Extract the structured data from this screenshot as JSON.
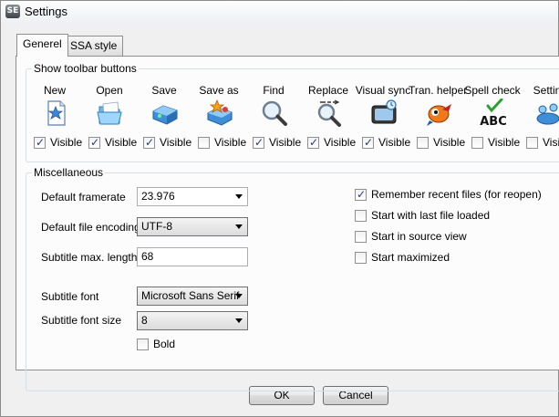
{
  "window": {
    "title": "Settings",
    "icon_text": "SE"
  },
  "tabs": [
    {
      "label": "Generel",
      "active": true
    },
    {
      "label": "SSA style",
      "active": false
    }
  ],
  "toolbar_group": {
    "title": "Show toolbar buttons",
    "visible_label": "Visible",
    "items": [
      {
        "label": "New",
        "icon": "new-file-star-icon",
        "visible": true
      },
      {
        "label": "Open",
        "icon": "open-folder-icon",
        "visible": true
      },
      {
        "label": "Save",
        "icon": "save-drive-icon",
        "visible": true
      },
      {
        "label": "Save as",
        "icon": "save-as-star-icon",
        "visible": false
      },
      {
        "label": "Find",
        "icon": "magnifier-icon",
        "visible": true
      },
      {
        "label": "Replace",
        "icon": "replace-magnifier-icon",
        "visible": true
      },
      {
        "label": "Visual sync",
        "icon": "visual-sync-tv-icon",
        "visible": true
      },
      {
        "label": "Tran. helper",
        "icon": "translate-helper-icon",
        "visible": false
      },
      {
        "label": "Spell check",
        "icon": "spell-check-abc-icon",
        "visible": false
      },
      {
        "label": "Settin",
        "icon": "settings-icon",
        "visible": false
      }
    ]
  },
  "misc_group": {
    "title": "Miscellaneous",
    "framerate": {
      "label": "Default framerate",
      "value": "23.976"
    },
    "encoding": {
      "label": "Default file encoding",
      "value": "UTF-8"
    },
    "max_length": {
      "label": "Subtitle max. length",
      "value": "68"
    },
    "font": {
      "label": "Subtitle font",
      "value": "Microsoft Sans Serif"
    },
    "font_size": {
      "label": "Subtitle font size",
      "value": "8"
    },
    "bold": {
      "label": "Bold",
      "checked": false
    },
    "options": [
      {
        "label": "Remember recent files (for reopen)",
        "checked": true
      },
      {
        "label": "Start with last file loaded",
        "checked": false
      },
      {
        "label": "Start in source view",
        "checked": false
      },
      {
        "label": "Start maximized",
        "checked": false
      }
    ]
  },
  "buttons": {
    "ok": "OK",
    "cancel": "Cancel"
  },
  "colors": {
    "title_bar": "#eef0f3",
    "dialog_bg": "#f0f0f0",
    "panel_bg": "#fcfcfc",
    "check_mark": "#1b3f8b",
    "group_border": "#d5dfe5"
  }
}
